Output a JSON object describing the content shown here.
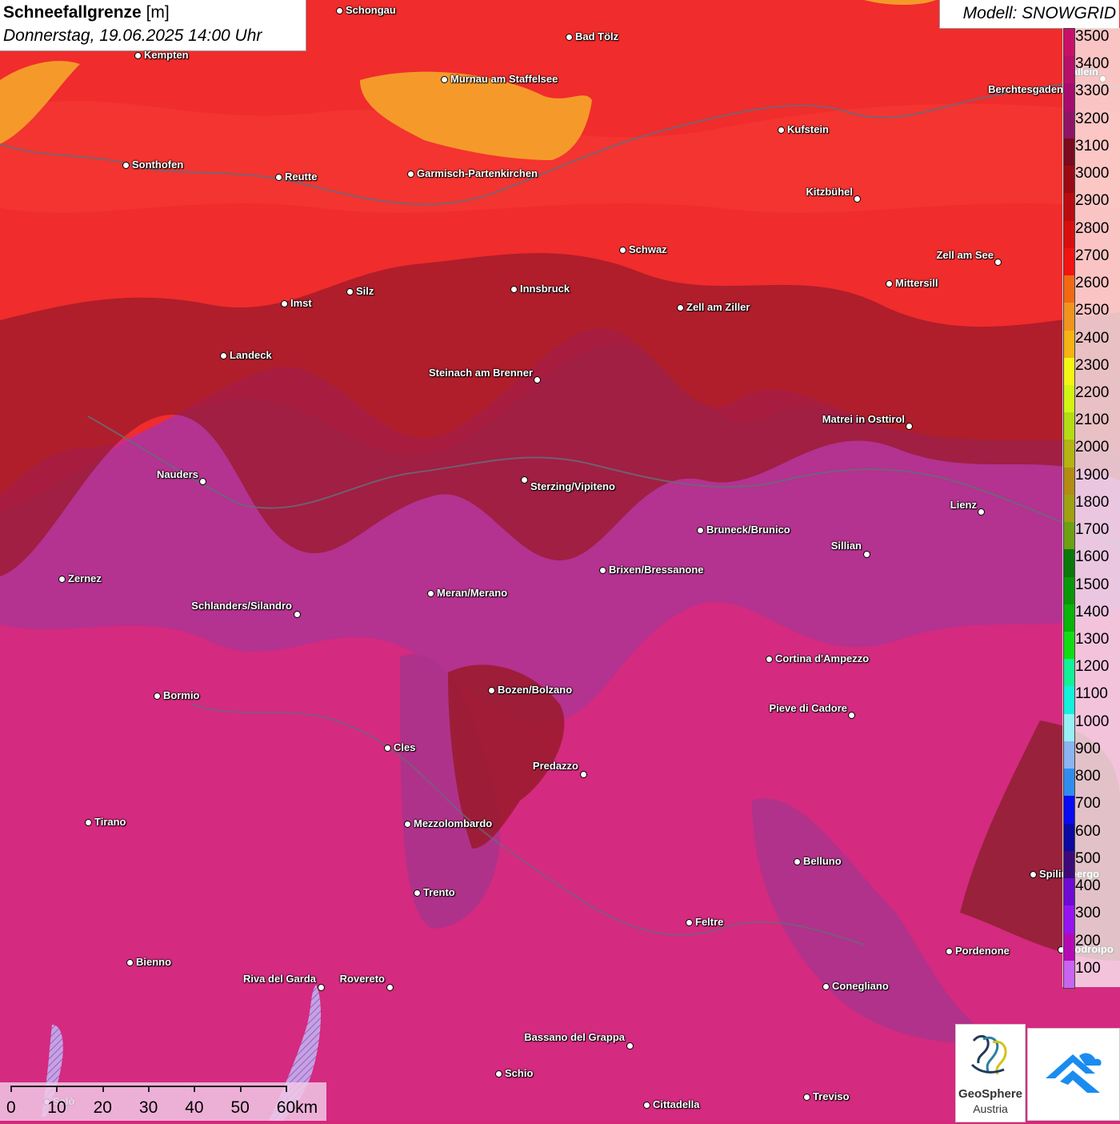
{
  "title": {
    "name": "Schneefallgrenze",
    "unit": "[m]",
    "datetime": "Donnerstag, 19.06.2025 14:00 Uhr"
  },
  "model": "Modell: SNOWGRID",
  "legend": {
    "labels": [
      "3500",
      "3400",
      "3300",
      "3200",
      "3100",
      "3000",
      "2900",
      "2800",
      "2700",
      "2600",
      "2500",
      "2400",
      "2300",
      "2200",
      "2100",
      "2000",
      "1900",
      "1800",
      "1700",
      "1600",
      "1500",
      "1400",
      "1300",
      "1200",
      "1100",
      "1000",
      "900",
      "800",
      "700",
      "600",
      "500",
      "400",
      "300",
      "200",
      "100"
    ],
    "colors": [
      "#c8106a",
      "#b5106a",
      "#a50c6e",
      "#8e1466",
      "#7a0a1e",
      "#9a0a14",
      "#b80c10",
      "#d80f0f",
      "#f01414",
      "#f06a14",
      "#f0941e",
      "#f5b414",
      "#f5f514",
      "#d2f514",
      "#b4dc14",
      "#b4b414",
      "#b48c14",
      "#a0a014",
      "#6ea014",
      "#0a780a",
      "#0a960a",
      "#0ab40a",
      "#14dc14",
      "#14f096",
      "#14f0dc",
      "#96f0f5",
      "#8cb4f0",
      "#328cf0",
      "#0a0af0",
      "#0a0aa0",
      "#3c0a78",
      "#6e0ad2",
      "#9614f0",
      "#b40ab4",
      "#c864f0"
    ]
  },
  "cities": [
    {
      "name": "Schongau"
    },
    {
      "name": "Bad Tölz"
    },
    {
      "name": "Kempten"
    },
    {
      "name": "Murnau am Staffelsee"
    },
    {
      "name": "Berchtesgaden"
    },
    {
      "name": "Hallein"
    },
    {
      "name": "Kufstein"
    },
    {
      "name": "Sonthofen"
    },
    {
      "name": "Reutte"
    },
    {
      "name": "Garmisch-Partenkirchen"
    },
    {
      "name": "Kitzbühel"
    },
    {
      "name": "Schwaz"
    },
    {
      "name": "Zell am See"
    },
    {
      "name": "Innsbruck"
    },
    {
      "name": "Mittersill"
    },
    {
      "name": "Imst"
    },
    {
      "name": "Silz"
    },
    {
      "name": "Zell am Ziller"
    },
    {
      "name": "Landeck"
    },
    {
      "name": "Steinach am Brenner"
    },
    {
      "name": "Matrei in Osttirol"
    },
    {
      "name": "Nauders"
    },
    {
      "name": "Sterzing/Vipiteno"
    },
    {
      "name": "Lienz"
    },
    {
      "name": "Bruneck/Brunico"
    },
    {
      "name": "Sillian"
    },
    {
      "name": "Zernez"
    },
    {
      "name": "Brixen/Bressanone"
    },
    {
      "name": "Meran/Merano"
    },
    {
      "name": "Schlanders/Silandro"
    },
    {
      "name": "Cortina d'Ampezzo"
    },
    {
      "name": "Bormio"
    },
    {
      "name": "Bozen/Bolzano"
    },
    {
      "name": "Pieve di Cadore"
    },
    {
      "name": "Cles"
    },
    {
      "name": "Predazzo"
    },
    {
      "name": "Tirano"
    },
    {
      "name": "Mezzolombardo"
    },
    {
      "name": "Belluno"
    },
    {
      "name": "Spilimbergo"
    },
    {
      "name": "Trento"
    },
    {
      "name": "Feltre"
    },
    {
      "name": "Pordenone"
    },
    {
      "name": "Bienno"
    },
    {
      "name": "Riva del Garda"
    },
    {
      "name": "Rovereto"
    },
    {
      "name": "Conegliano"
    },
    {
      "name": "Bassano del Grappa"
    },
    {
      "name": "Schio"
    },
    {
      "name": "Treviso"
    },
    {
      "name": "Cittadella"
    },
    {
      "name": "Salò"
    },
    {
      "name": "Codroipo"
    }
  ],
  "scale": {
    "labels": [
      "0",
      "10",
      "20",
      "30",
      "40",
      "50",
      "60km"
    ]
  },
  "logos": {
    "geosphere_name": "GeoSphere",
    "geosphere_sub": "Austria"
  }
}
